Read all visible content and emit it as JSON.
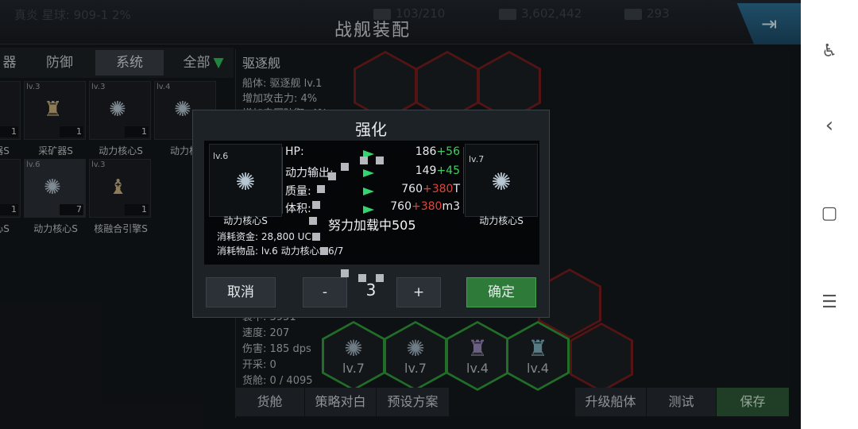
{
  "header": {
    "location": "真炎  星球: 909-1  2%",
    "title": "战舰装配",
    "cargo": "103/210",
    "credits": "3,602,442",
    "crystals": "293"
  },
  "tabs": [
    {
      "label": "器"
    },
    {
      "label": "防御"
    },
    {
      "label": "系统"
    },
    {
      "label": "全部"
    }
  ],
  "inventory": [
    {
      "lv": "",
      "count": "1",
      "label": "器S"
    },
    {
      "lv": "lv.3",
      "count": "1",
      "label": "采矿器S"
    },
    {
      "lv": "lv.3",
      "count": "1",
      "label": "动力核心S"
    },
    {
      "lv": "lv.4",
      "count": "",
      "label": "动力核"
    },
    {
      "lv": "",
      "count": "1",
      "label": "心S"
    },
    {
      "lv": "lv.6",
      "count": "7",
      "label": "动力核心S"
    },
    {
      "lv": "lv.3",
      "count": "1",
      "label": "核融合引擎S"
    }
  ],
  "ship": {
    "name": "驱逐舰",
    "hull": "船体: 驱逐舰 lv.1",
    "attack": "增加攻击力: 4%",
    "partial": "增加电压防御: 4%",
    "hp": "装甲: 3951",
    "speed": "速度: 207",
    "damage": "伤害: 185 dps",
    "mining": "开采: 0",
    "cargo": "货舱: 0 / 4095"
  },
  "hexes": [
    {
      "lvl": "lv.7"
    },
    {
      "lvl": "lv.7"
    },
    {
      "lvl": "lv.4"
    },
    {
      "lvl": "lv.4"
    }
  ],
  "bottom": {
    "cargo": "货舱",
    "strategy": "策略对白",
    "preset": "预设方案",
    "upgrade": "升级船体",
    "test": "测试",
    "save": "保存"
  },
  "dialog": {
    "title": "强化",
    "left_lv": "lv.6",
    "left_name": "动力核心S",
    "right_lv": "lv.7",
    "right_name": "动力核心S",
    "stats": [
      {
        "label": "HP:",
        "base": "186",
        "inc": "+56",
        "unit": ""
      },
      {
        "label": "动力输出:",
        "base": "149",
        "inc": "+45",
        "unit": ""
      },
      {
        "label": "质量:",
        "base": "760",
        "inc": "+380",
        "unit": "T"
      },
      {
        "label": "体积:",
        "base": "760",
        "inc": "+380",
        "unit": "m3"
      }
    ],
    "cost_money": "消耗资金: 28,800 UCP",
    "cost_item": "消耗物品: lv.6 动力核心S 6/7",
    "loading": "努力加载中505",
    "cancel": "取消",
    "minus": "-",
    "qty": "3",
    "plus": "+",
    "confirm": "确定"
  },
  "colors": {
    "increase_green": "#3fd15f",
    "increase_red": "#e0453b",
    "confirm_green": "#2e7a39"
  }
}
